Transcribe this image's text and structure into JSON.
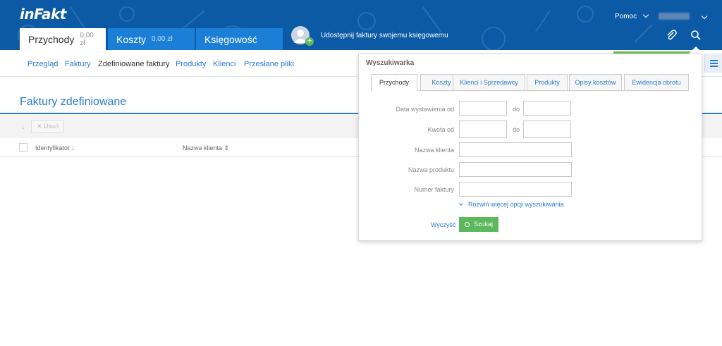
{
  "app": {
    "logo": "inFakt"
  },
  "main_tabs": [
    {
      "label": "Przychody",
      "amount": "0,00 zł"
    },
    {
      "label": "Koszty",
      "amount": "0,00 zł"
    },
    {
      "label": "Księgowość"
    }
  ],
  "share": {
    "label": "Udostępnij faktury swojemu księgowemu"
  },
  "header": {
    "help_label": "Pomoc"
  },
  "subnav": [
    "Przegląd",
    "Faktury",
    "Zdefiniowane faktury",
    "Produkty",
    "Klienci",
    "Przesłane pliki"
  ],
  "page": {
    "title": "Faktury zdefiniowane",
    "delete_label": "Usuń"
  },
  "table": {
    "headers": [
      "Identyfikator",
      "Nazwa klienta"
    ]
  },
  "search_panel": {
    "title": "Wyszukiwarka",
    "tabs": [
      "Przychody",
      "Koszty",
      "Klienci i Sprzedawcy",
      "Produkty",
      "Opisy kosztów",
      "Ewidencja obrotu"
    ],
    "fields": {
      "date_from": "Data wystawienia od",
      "to": "do",
      "amount_from": "Kwota od",
      "client_name": "Nazwa klienta",
      "product_name": "Nazwa produktu",
      "invoice_number": "Numer faktury"
    },
    "more_options": "Rozwiń więcej opcji wyszukiwania",
    "clear_label": "Wyczyść",
    "search_label": "Szukaj"
  },
  "colors": {
    "header_bg": "#0c5aa6",
    "accent": "#2a7bd1",
    "success": "#5cb85c"
  }
}
